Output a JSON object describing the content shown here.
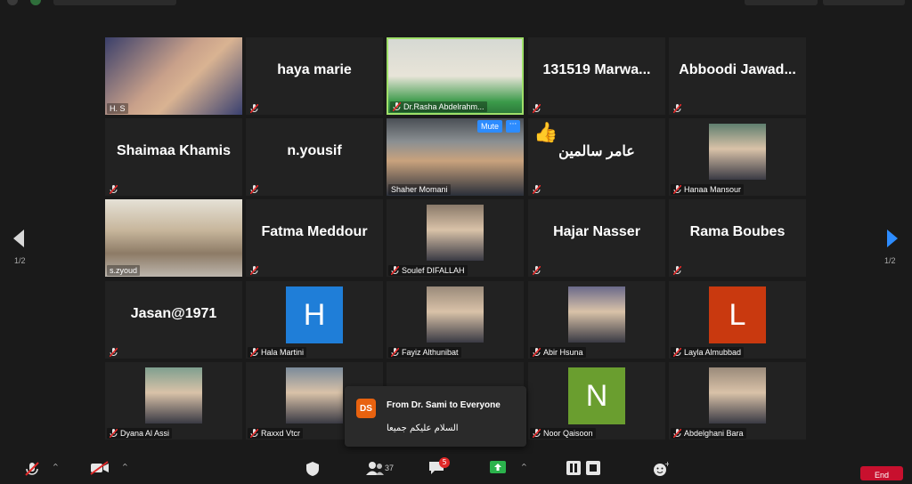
{
  "pagination": {
    "current": "1/2"
  },
  "participants": [
    {
      "type": "video",
      "name": "H. S",
      "muted": false
    },
    {
      "type": "name",
      "name": "haya marie",
      "muted": true
    },
    {
      "type": "video",
      "name": "Dr.Rasha Abdelrahm...",
      "muted": true,
      "active_speaker": true
    },
    {
      "type": "name",
      "name": "131519  Marwa...",
      "muted": true
    },
    {
      "type": "name",
      "name": "Abboodi  Jawad...",
      "muted": true
    },
    {
      "type": "name",
      "name": "Shaimaa Khamis",
      "muted": true
    },
    {
      "type": "name",
      "name": "n.yousif",
      "muted": true
    },
    {
      "type": "video",
      "name": "Shaher Momani",
      "muted": false,
      "hover": true
    },
    {
      "type": "name",
      "name": "عامر سالمين",
      "muted": true,
      "reaction": "👍"
    },
    {
      "type": "photo",
      "name": "Hanaa Mansour",
      "muted": true
    },
    {
      "type": "video",
      "name": "s.zyoud",
      "muted": false
    },
    {
      "type": "name",
      "name": "Fatma Meddour",
      "muted": true
    },
    {
      "type": "photo",
      "name": "Soulef DIFALLAH",
      "muted": true
    },
    {
      "type": "name",
      "name": "Hajar Nasser",
      "muted": true
    },
    {
      "type": "name",
      "name": "Rama Boubes",
      "muted": true
    },
    {
      "type": "name",
      "name": "Jasan@1971",
      "muted": true
    },
    {
      "type": "letter",
      "name": "Hala Martini",
      "letter": "H",
      "color": "#1f7ed8",
      "muted": true
    },
    {
      "type": "photo",
      "name": "Fayiz Althunibat",
      "muted": true
    },
    {
      "type": "photo",
      "name": "Abir Hsuna",
      "muted": true
    },
    {
      "type": "letter",
      "name": "Layla Almubbad",
      "letter": "L",
      "color": "#c9390f",
      "muted": true
    },
    {
      "type": "photo",
      "name": "Dyana Al Assi",
      "muted": true
    },
    {
      "type": "photo",
      "name": "Raxxd Vtcr",
      "muted": true
    },
    {
      "type": "hidden",
      "name": "",
      "muted": false
    },
    {
      "type": "letter",
      "name": "Noor Qaisoon",
      "letter": "N",
      "color": "#6a9e2f",
      "muted": true
    },
    {
      "type": "photo",
      "name": "Abdelghani Bara",
      "muted": true
    }
  ],
  "hover_controls": {
    "mute_label": "Mute",
    "more_label": "···"
  },
  "chat_toast": {
    "initials": "DS",
    "from": "From Dr. Sami to Everyone",
    "message": "السلام عليكم جميعا"
  },
  "toolbar": {
    "participants_count": "37",
    "chat_badge": "5",
    "end_label": "End"
  },
  "colors": {
    "speaker_border": "#9fe06a",
    "accent": "#2d8cff",
    "end": "#c8102e",
    "ds": "#e8620f"
  }
}
